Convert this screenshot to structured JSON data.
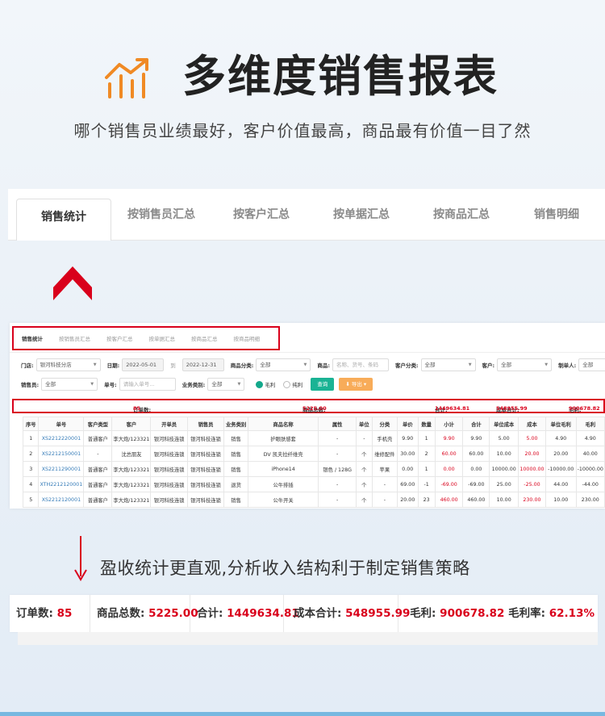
{
  "hero": {
    "icon": "bar-chart-icon",
    "title": "多维度销售报表"
  },
  "subtitle": "哪个销售员业绩最好，客户价值最高，商品最有价值一目了然",
  "big_tabs": [
    "销售统计",
    "按销售员汇总",
    "按客户汇总",
    "按单据汇总",
    "按商品汇总",
    "销售明细"
  ],
  "screenshot": {
    "tabs": [
      "销售统计",
      "按销售员汇总",
      "按客户汇总",
      "按单据汇总",
      "按商品汇总",
      "按商品明细"
    ],
    "filters": {
      "store_label": "门店:",
      "store_value": "银河科技分店",
      "date_label": "日期:",
      "date_from": "2022-05-01",
      "date_sep": "到",
      "date_to": "2022-12-31",
      "category_label": "商品分类:",
      "category_value": "全部",
      "product_label": "商品:",
      "product_placeholder": "名称、货号、条码",
      "customer_type_label": "客户分类:",
      "customer_type_value": "全部",
      "customer_label": "客户:",
      "customer_value": "全部",
      "creator_label": "制单人:",
      "creator_value": "全部",
      "seller_label": "销售员:",
      "seller_value": "全部",
      "order_label": "单号:",
      "order_placeholder": "请输入单号...",
      "biz_label": "业务类别:",
      "biz_value": "全部",
      "radio_gross": "毛利",
      "radio_net": "纯利",
      "query_btn": "查询",
      "export_btn": "导出"
    },
    "summary": {
      "orders_label": "订单数:",
      "orders_value": "85",
      "qty_label": "商品总数:",
      "qty_value": "5225.00",
      "total_label": "合计:",
      "total_value": "1449634.81",
      "cost_label": "成本合计:",
      "cost_value": "548955.99",
      "profit_label": "毛利:",
      "profit_value": "900678.82"
    },
    "columns": [
      "序号",
      "单号",
      "客户类型",
      "客户",
      "开单员",
      "销售员",
      "业务类别",
      "商品名称",
      "属性",
      "单位",
      "分类",
      "单价",
      "数量",
      "小计",
      "合计",
      "单位成本",
      "成本",
      "单位毛利",
      "毛利"
    ],
    "rows": [
      [
        "1",
        "XS2212220001",
        "普通客户",
        "李大炮/123321",
        "银河科技连锁",
        "银河科技连锁",
        "销售",
        "护眼肤感套",
        "-",
        "-",
        "手机壳",
        "9.90",
        "1",
        "9.90",
        "9.90",
        "5.00",
        "5.00",
        "4.90",
        "4.90"
      ],
      [
        "2",
        "XS2212150001",
        "-",
        "沈总朋友",
        "银河科技连锁",
        "银河科技连锁",
        "销售",
        "DV 凯夫拉纤维壳",
        "-",
        "个",
        "维修配件",
        "30.00",
        "2",
        "60.00",
        "60.00",
        "10.00",
        "20.00",
        "20.00",
        "40.00"
      ],
      [
        "3",
        "XS2211290001",
        "普通客户",
        "李大炮/123321",
        "银河科技连锁",
        "银河科技连锁",
        "销售",
        "iPhone14",
        "银色 / 128G",
        "个",
        "苹果",
        "0.00",
        "1",
        "0.00",
        "0.00",
        "10000.00",
        "10000.00",
        "-10000.00",
        "-10000.00"
      ],
      [
        "4",
        "XTH2212120001",
        "普通客户",
        "李大炮/123321",
        "银河科技连锁",
        "银河科技连锁",
        "退货",
        "公牛排插",
        "-",
        "个",
        "-",
        "69.00",
        "-1",
        "-69.00",
        "-69.00",
        "25.00",
        "-25.00",
        "44.00",
        "-44.00"
      ],
      [
        "5",
        "XS2212120001",
        "普通客户",
        "李大炮/123321",
        "银河科技连锁",
        "银河科技连锁",
        "销售",
        "公牛开关",
        "-",
        "个",
        "-",
        "20.00",
        "23",
        "460.00",
        "460.00",
        "10.00",
        "230.00",
        "10.00",
        "230.00"
      ]
    ]
  },
  "caption": "盈收统计更直观,分析收入结构利于制定销售策略",
  "summary_big": {
    "orders_label": "订单数:",
    "orders_value": "85",
    "qty_label": "商品总数:",
    "qty_value": "5225.00",
    "total_label": "合计:",
    "total_value": "1449634.81",
    "cost_label": "成本合计:",
    "cost_value": "548955.99",
    "profit_label": "毛利:",
    "profit_value": "900678.82",
    "rate_label": "毛利率:",
    "rate_value": "62.13%"
  },
  "colors": {
    "accent": "#d9001b",
    "orange": "#f08a24",
    "link": "#337ab7",
    "query": "#1ab394",
    "export": "#f8ac59"
  }
}
